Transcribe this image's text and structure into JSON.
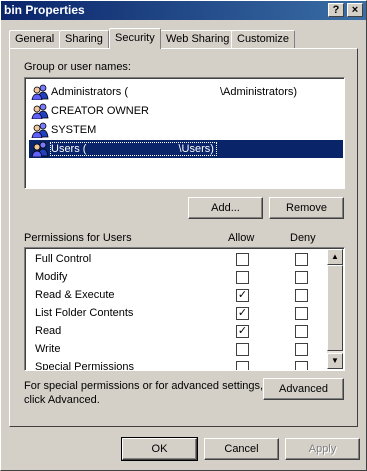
{
  "window": {
    "title": "bin Properties",
    "help_button": "?",
    "close_button": "×"
  },
  "tabs": [
    {
      "label": "General",
      "active": false
    },
    {
      "label": "Sharing",
      "active": false
    },
    {
      "label": "Security",
      "active": true
    },
    {
      "label": "Web Sharing",
      "active": false
    },
    {
      "label": "Customize",
      "active": false
    }
  ],
  "security": {
    "group_label": "Group or user names:",
    "users": [
      {
        "name": "Administrators (",
        "suffix": "\\Administrators)",
        "selected": false
      },
      {
        "name": "CREATOR OWNER",
        "suffix": "",
        "selected": false
      },
      {
        "name": "SYSTEM",
        "suffix": "",
        "selected": false
      },
      {
        "name": "Users (",
        "suffix": "\\Users)",
        "selected": true
      }
    ],
    "add_button": "Add...",
    "remove_button": "Remove",
    "permissions_label": "Permissions for Users",
    "allow_header": "Allow",
    "deny_header": "Deny",
    "permissions": [
      {
        "name": "Full Control",
        "allow": false,
        "deny": false
      },
      {
        "name": "Modify",
        "allow": false,
        "deny": false
      },
      {
        "name": "Read & Execute",
        "allow": true,
        "deny": false
      },
      {
        "name": "List Folder Contents",
        "allow": true,
        "deny": false
      },
      {
        "name": "Read",
        "allow": true,
        "deny": false
      },
      {
        "name": "Write",
        "allow": false,
        "deny": false
      },
      {
        "name": "Special Permissions",
        "allow": false,
        "deny": false
      }
    ],
    "advanced_text_line1": "For special permissions or for advanced settings,",
    "advanced_text_line2": "click Advanced.",
    "advanced_button": "Advanced"
  },
  "footer": {
    "ok_button": "OK",
    "cancel_button": "Cancel",
    "apply_button": "Apply"
  },
  "icons": {
    "user_group": "user-group-icon",
    "checkmark": "✓"
  },
  "colors": {
    "titlebar": "#0a246a",
    "selection": "#0a246a",
    "face": "#d4d0c8"
  }
}
